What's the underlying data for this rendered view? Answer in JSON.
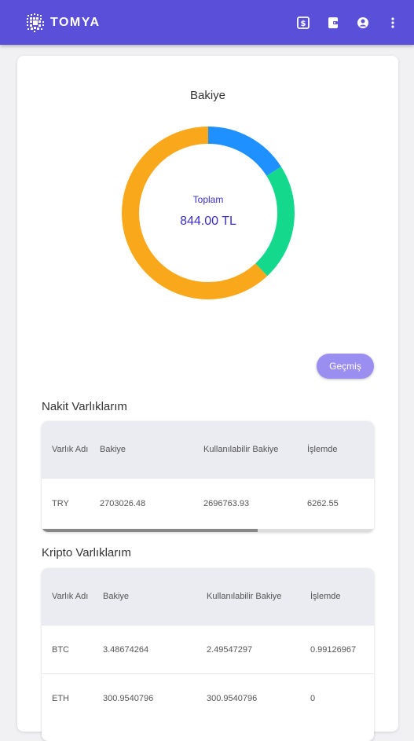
{
  "app": {
    "brand": "TOMYA"
  },
  "header": {
    "icons": [
      "dollar-icon",
      "wallet-icon",
      "account-icon",
      "more-vert-icon"
    ]
  },
  "balance": {
    "title": "Bakiye",
    "total_label": "Toplam",
    "total_value": "844.00 TL"
  },
  "chart_data": {
    "type": "pie",
    "values": [
      0.16,
      0.22,
      0.62
    ],
    "colors": [
      "#1e90ff",
      "#14d98c",
      "#f9a81b"
    ]
  },
  "history_button": "Geçmiş",
  "cash": {
    "title": "Nakit Varlıklarım",
    "headers": [
      "Varlık Adı",
      "Bakiye",
      "Kullanılabilir Bakiye",
      "İşlemde"
    ],
    "rows": [
      [
        "TRY",
        "2703026.48",
        "2696763.93",
        "6262.55"
      ]
    ]
  },
  "crypto": {
    "title": "Kripto Varlıklarım",
    "headers": [
      "Varlık Adı",
      "Bakiye",
      "Kullanılabilir Bakiye",
      "İşlemde"
    ],
    "rows": [
      [
        "BTC",
        "3.48674264",
        "2.49547297",
        "0.99126967"
      ],
      [
        "ETH",
        "300.9540796",
        "300.9540796",
        "0"
      ]
    ]
  }
}
